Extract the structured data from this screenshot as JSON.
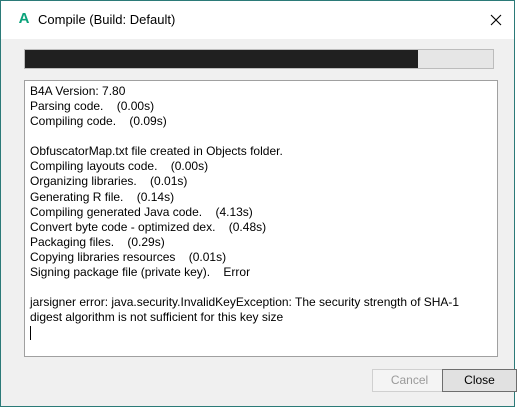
{
  "window": {
    "title": "Compile (Build: Default)",
    "logo_letter": "A",
    "accent_color": "#0aa27a"
  },
  "progress": {
    "value": 0.84
  },
  "log": {
    "lines": [
      "B4A Version: 7.80",
      "Parsing code.    (0.00s)",
      "Compiling code.    (0.09s)",
      "",
      "ObfuscatorMap.txt file created in Objects folder.",
      "Compiling layouts code.    (0.00s)",
      "Organizing libraries.    (0.01s)",
      "Generating R file.    (0.14s)",
      "Compiling generated Java code.    (4.13s)",
      "Convert byte code - optimized dex.    (0.48s)",
      "Packaging files.    (0.29s)",
      "Copying libraries resources    (0.01s)",
      "Signing package file (private key).    Error",
      "",
      "jarsigner error: java.security.InvalidKeyException: The security strength of SHA-1 digest algorithm is not sufficient for this key size"
    ]
  },
  "buttons": {
    "cancel_label": "Cancel",
    "close_label": "Close"
  }
}
